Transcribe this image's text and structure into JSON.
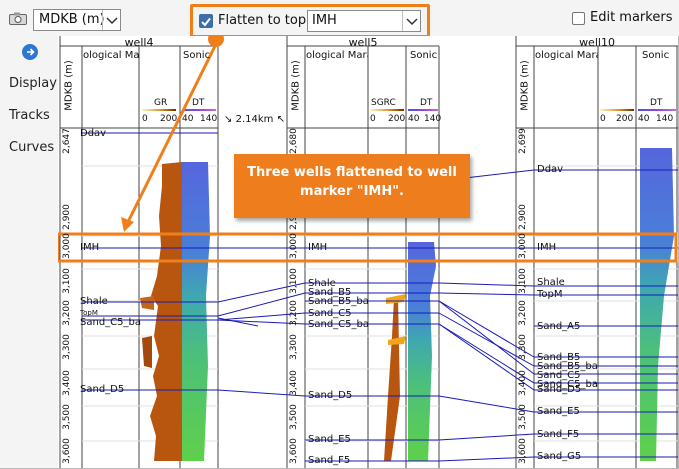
{
  "toolbar": {
    "depth_unit": "MDKB (m)",
    "flatten_label": "Flatten to top:",
    "flatten_checked": true,
    "flatten_marker": "IMH",
    "edit_markers_label": "Edit markers",
    "edit_markers_checked": false
  },
  "side_panel": {
    "items": [
      "Display",
      "Tracks",
      "Curves"
    ]
  },
  "wells": [
    {
      "name": "well4",
      "depth_label": "MDKB (m)",
      "track_title": "ological Marammа R",
      "log_track_title": "Sonic",
      "curves": [
        {
          "name": "GR",
          "min": "0",
          "max": "200"
        },
        {
          "name": "DT",
          "min": "40",
          "max": "140"
        }
      ],
      "spacing_label": "2.14km",
      "depth_ticks": [
        "2,647",
        "2,900",
        "3,000",
        "3,100",
        "3,200",
        "3,300",
        "3,400",
        "3,500",
        "3,600"
      ],
      "markers": [
        "Ddav",
        "IMH",
        "Shale",
        "TopM",
        "Sand_C5_ba",
        "Sand_D5"
      ]
    },
    {
      "name": "well5",
      "depth_label": "MDKB (m)",
      "track_title": "ological Marammа R",
      "log_track_title": "Sonic",
      "curves": [
        {
          "name": "SGRC",
          "min": "0",
          "max": "200"
        },
        {
          "name": "DT",
          "min": "40",
          "max": "140"
        }
      ],
      "depth_ticks": [
        "2,680",
        "2,900",
        "3,000",
        "3,100",
        "3,200",
        "3,300",
        "3,400",
        "3,500",
        "3,600"
      ],
      "markers": [
        "IMH",
        "Shale",
        "Sand_B5",
        "Sand_B5_ba",
        "Sand_C5",
        "Sand_C5_ba",
        "Sand_D5",
        "Sand_E5",
        "Sand_F5"
      ]
    },
    {
      "name": "well10",
      "depth_label": "MDKB (m)",
      "track_title": "ological Marammа R",
      "log_track_title": "Sonic",
      "curves": [
        {
          "name": "",
          "min": "0",
          "max": "200"
        },
        {
          "name": "DT",
          "min": "40",
          "max": "140"
        }
      ],
      "depth_ticks": [
        "2,699",
        "2,900",
        "3,000",
        "3,100",
        "3,200",
        "3,300",
        "3,400",
        "3,500",
        "3,600"
      ],
      "markers": [
        "Ddav",
        "IMH",
        "Shale",
        "TopM",
        "Sand_A5",
        "Sand_B5",
        "Sand_B5_ba",
        "Sand_C5",
        "Sand_C5_ba",
        "Sand_D5",
        "Sand_E5",
        "Sand_F5",
        "Sand_G5"
      ]
    }
  ],
  "annotation": {
    "callout_text": "Three wells flattened to well marker \"IMH\".",
    "highlight_color": "#f07f1a"
  },
  "colors": {
    "marker_line": "#1a1ab8",
    "gr_fill": "#b8560f",
    "sonic_top": "#5566dd",
    "sonic_bottom": "#55cc44"
  },
  "icons": {
    "camera": "camera-icon",
    "nav": "navigation-icon"
  }
}
